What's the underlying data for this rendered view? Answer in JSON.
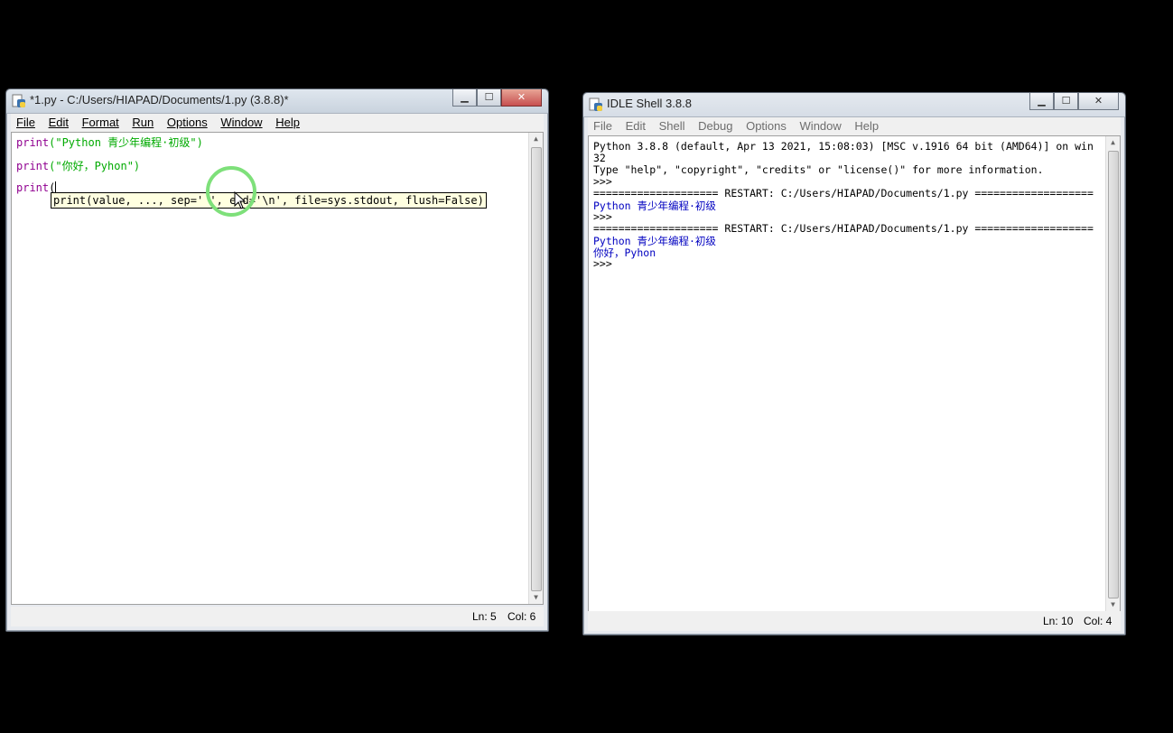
{
  "editor_window": {
    "title": "*1.py - C:/Users/HIAPAD/Documents/1.py (3.8.8)*",
    "menu": [
      "File",
      "Edit",
      "Format",
      "Run",
      "Options",
      "Window",
      "Help"
    ],
    "lines": [
      {
        "kw": "print",
        "rest": "(\"Python 青少年编程·初级\")"
      },
      {
        "kw": "print",
        "rest": "(\"你好，Pyhon\")"
      },
      {
        "kw": "print",
        "rest": "("
      }
    ],
    "calltip": "print(value, ..., sep=' ', end='\\n', file=sys.stdout, flush=False)",
    "status": {
      "ln": "Ln: 5",
      "col": "Col: 6"
    }
  },
  "shell_window": {
    "title": "IDLE Shell 3.8.8",
    "menu": [
      "File",
      "Edit",
      "Shell",
      "Debug",
      "Options",
      "Window",
      "Help"
    ],
    "lines": [
      {
        "text": "Python 3.8.8 (default, Apr 13 2021, 15:08:03) [MSC v.1916 64 bit (AMD64)] on win",
        "cls": "dk"
      },
      {
        "text": "32",
        "cls": "dk"
      },
      {
        "text": "Type \"help\", \"copyright\", \"credits\" or \"license()\" for more information.",
        "cls": "dk"
      },
      {
        "text": ">>>",
        "cls": "dk"
      },
      {
        "text": "==================== RESTART: C:/Users/HIAPAD/Documents/1.py ===================",
        "cls": "dk"
      },
      {
        "text": "Python 青少年编程·初级",
        "cls": "out"
      },
      {
        "text": ">>>",
        "cls": "dk"
      },
      {
        "text": "==================== RESTART: C:/Users/HIAPAD/Documents/1.py ===================",
        "cls": "dk"
      },
      {
        "text": "Python 青少年编程·初级",
        "cls": "out"
      },
      {
        "text": "你好，Pyhon",
        "cls": "out"
      },
      {
        "text": ">>>",
        "cls": "dk"
      }
    ],
    "status": {
      "ln": "Ln: 10",
      "col": "Col: 4"
    }
  },
  "icons": {
    "app": "python-idle-icon",
    "minimize": "minimize-icon",
    "maximize": "maximize-icon",
    "close": "close-icon"
  }
}
